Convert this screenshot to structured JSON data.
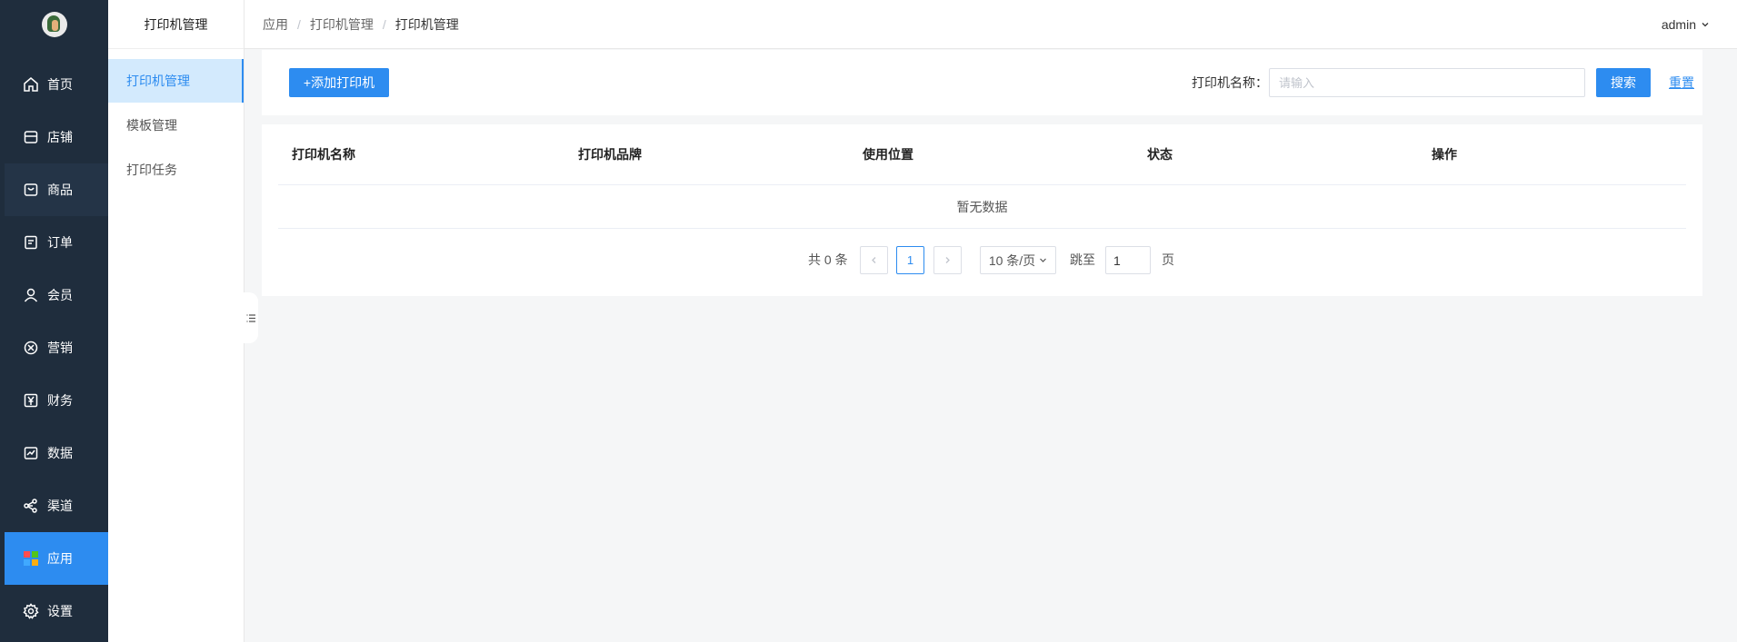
{
  "sidebar": {
    "items": [
      {
        "label": "首页",
        "icon": "home-icon"
      },
      {
        "label": "店铺",
        "icon": "shop-icon"
      },
      {
        "label": "商品",
        "icon": "bag-icon"
      },
      {
        "label": "订单",
        "icon": "order-icon"
      },
      {
        "label": "会员",
        "icon": "user-icon"
      },
      {
        "label": "营销",
        "icon": "marketing-icon"
      },
      {
        "label": "财务",
        "icon": "yen-icon"
      },
      {
        "label": "数据",
        "icon": "chart-icon"
      },
      {
        "label": "渠道",
        "icon": "share-icon"
      },
      {
        "label": "应用",
        "icon": "apps-icon"
      },
      {
        "label": "设置",
        "icon": "gear-icon"
      }
    ],
    "active_index": 9,
    "hover_index": 2
  },
  "subnav": {
    "title": "打印机管理",
    "items": [
      {
        "label": "打印机管理"
      },
      {
        "label": "模板管理"
      },
      {
        "label": "打印任务"
      }
    ],
    "active_index": 0
  },
  "header": {
    "breadcrumb": [
      "应用",
      "打印机管理",
      "打印机管理"
    ],
    "separator": "/",
    "user": "admin"
  },
  "toolbar": {
    "add_label": "+添加打印机",
    "search_label": "打印机名称：",
    "search_placeholder": "请输入",
    "search_button": "搜索",
    "reset_button": "重置"
  },
  "table": {
    "columns": [
      "打印机名称",
      "打印机品牌",
      "使用位置",
      "状态",
      "操作"
    ],
    "empty_text": "暂无数据"
  },
  "pagination": {
    "total_text": "共 0 条",
    "current_page": "1",
    "prev_icon": "chevron-left-icon",
    "next_icon": "chevron-right-icon",
    "page_size": "10 条/页",
    "jump_label": "跳至",
    "jump_value": "1",
    "page_suffix": "页"
  },
  "colors": {
    "sidebar_bg": "#1f2d3d",
    "accent": "#2d8cf0",
    "submenu_active_bg": "#d3eafd"
  }
}
